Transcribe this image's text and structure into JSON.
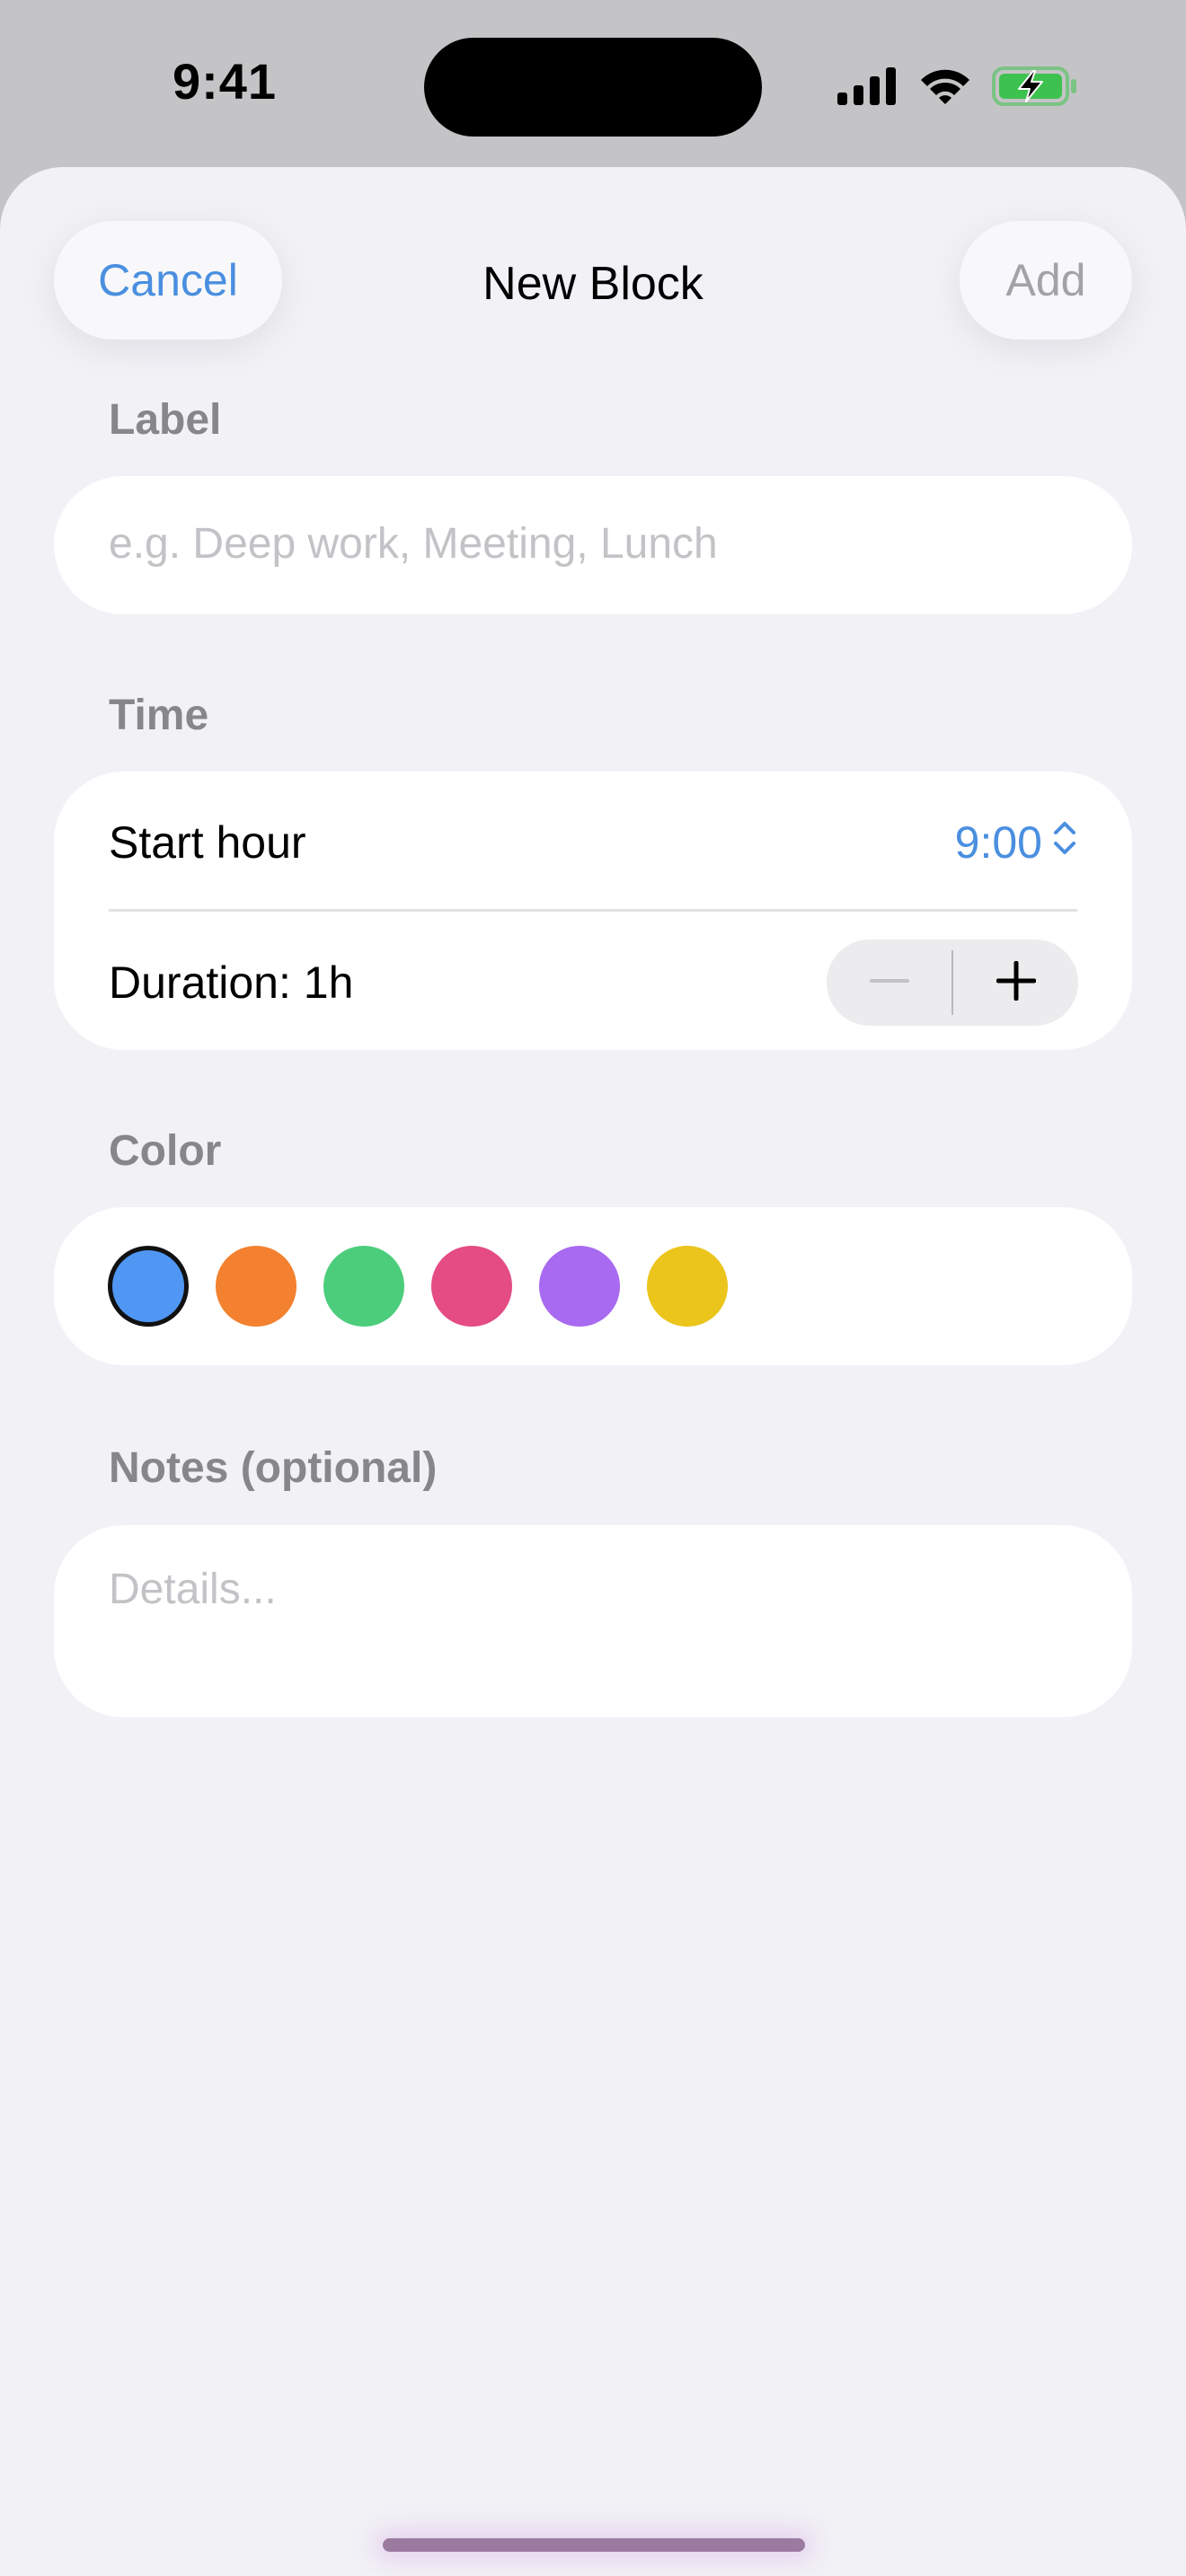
{
  "status_bar": {
    "time": "9:41"
  },
  "sheet": {
    "title": "New Block",
    "cancel_label": "Cancel",
    "add_label": "Add"
  },
  "label_section": {
    "header": "Label",
    "placeholder": "e.g. Deep work, Meeting, Lunch"
  },
  "time_section": {
    "header": "Time",
    "start_hour_label": "Start hour",
    "start_hour_value": "9:00",
    "duration_label": "Duration: 1h"
  },
  "color_section": {
    "header": "Color",
    "swatches": [
      {
        "name": "blue",
        "color": "#4f97f3",
        "selected": true
      },
      {
        "name": "orange",
        "color": "#f3812f",
        "selected": false
      },
      {
        "name": "green",
        "color": "#4ccd7c",
        "selected": false
      },
      {
        "name": "pink",
        "color": "#e44c83",
        "selected": false
      },
      {
        "name": "purple",
        "color": "#a86af0",
        "selected": false
      },
      {
        "name": "yellow",
        "color": "#ebc41c",
        "selected": false
      }
    ]
  },
  "notes_section": {
    "header": "Notes (optional)",
    "placeholder": "Details..."
  },
  "colors": {
    "accent": "#4a8fe0",
    "sheet_background": "#f2f1f6",
    "battery_green": "#3ec24f"
  },
  "icons": [
    "cellular-signal-icon",
    "wifi-icon",
    "battery-charging-icon",
    "chevron-up-down-icon",
    "minus-icon",
    "plus-icon"
  ]
}
